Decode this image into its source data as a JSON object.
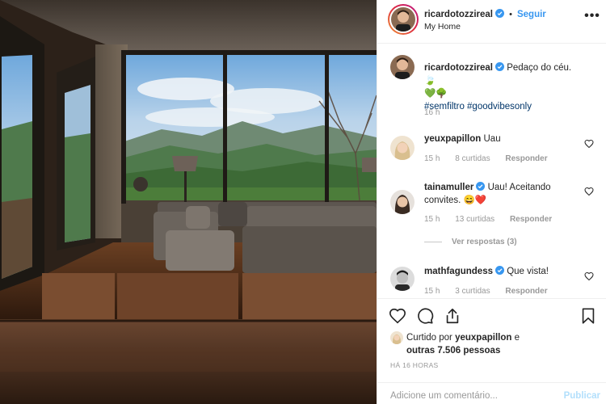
{
  "post": {
    "author": "ricardotozzireal",
    "separator": "•",
    "follow_label": "Seguir",
    "location": "My Home",
    "more_label": "•••"
  },
  "caption": {
    "author": "ricardotozzireal",
    "text": "Pedaço do céu.",
    "hashtags": "#semfiltro #goodvibesonly",
    "time": "16 h"
  },
  "comments": [
    {
      "user": "yeuxpapillon",
      "verified": false,
      "text": "Uau",
      "time": "15 h",
      "likes": "8 curtidas",
      "reply_label": "Responder"
    },
    {
      "user": "tainamuller",
      "verified": true,
      "text": "Uau! Aceitando convites.",
      "time": "15 h",
      "likes": "13 curtidas",
      "reply_label": "Responder"
    },
    {
      "user": "mathfagundess",
      "verified": true,
      "text": "Que vista!",
      "time": "15 h",
      "likes": "3 curtidas",
      "reply_label": "Responder"
    }
  ],
  "view_replies": "Ver respostas (3)",
  "likes": {
    "prefix": "Curtido por",
    "user": "yeuxpapillon",
    "conj": "e",
    "others": "outras 7.506 pessoas"
  },
  "timestamp": "HÁ 16 HORAS",
  "add_comment": {
    "placeholder": "Adicione um comentário...",
    "publish": "Publicar"
  },
  "icons": {
    "like": "heart-icon",
    "comment": "comment-icon",
    "share": "share-icon",
    "save": "bookmark-icon",
    "verified": "verified-badge-icon"
  },
  "colors": {
    "link": "#3897f0",
    "hashtag": "#003569",
    "verified": "#3897f0",
    "muted": "#999999"
  }
}
